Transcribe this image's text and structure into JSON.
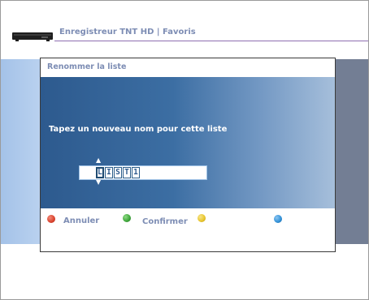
{
  "header": {
    "title": "Enregistreur TNT HD | Favoris",
    "device_icon": "set-top-box-icon"
  },
  "dialog": {
    "title": "Renommer la liste",
    "prompt": "Tapez un nouveau nom pour cette liste",
    "input": {
      "characters": [
        "L",
        "I",
        "S",
        "T",
        "1"
      ],
      "cursor_index": 0
    }
  },
  "footer": {
    "buttons": [
      {
        "color": "red",
        "hex": "#d9412c",
        "label": "Annuler"
      },
      {
        "color": "green",
        "hex": "#3da53a",
        "label": "Confirmer"
      },
      {
        "color": "yellow",
        "hex": "#e8c52a",
        "label": ""
      },
      {
        "color": "blue",
        "hex": "#2f8fd6",
        "label": ""
      }
    ]
  },
  "colors": {
    "accent": "#7d8db4",
    "dialog_body": "#2d5a8e",
    "header_line": "#8e6fb0"
  }
}
